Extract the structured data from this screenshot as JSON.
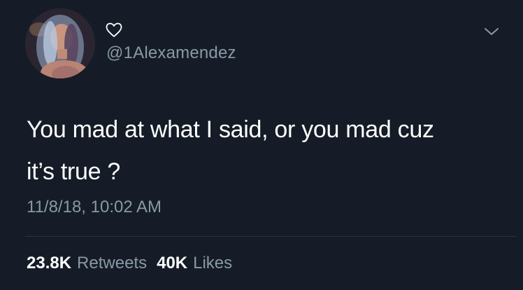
{
  "tweet": {
    "handle": "@1Alexamendez",
    "display_name_icon": "heart-outline-icon",
    "text": "You mad at what I said, or you mad cuz\nit’s true ?",
    "timestamp": "11/8/18, 10:02 AM",
    "stats": {
      "retweets_count": "23.8K",
      "retweets_label": "Retweets",
      "likes_count": "40K",
      "likes_label": "Likes"
    },
    "menu_icon": "chevron-down-icon"
  },
  "colors": {
    "background": "#151c27",
    "primary_text": "#ffffff",
    "secondary_text": "#8899a6",
    "divider": "#2a3441"
  }
}
